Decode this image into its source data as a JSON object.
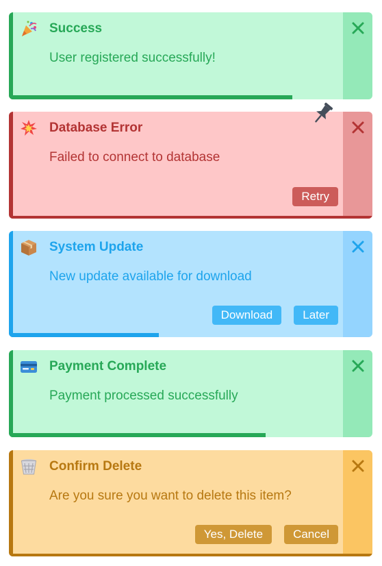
{
  "toasts": [
    {
      "type": "success",
      "icon": "party-popper-icon",
      "title": "Success",
      "message": "User registered successfully!",
      "close_label": "✕",
      "progress": 0.79,
      "actions": []
    },
    {
      "type": "error",
      "icon": "collision-icon",
      "title": "Database Error",
      "message": "Failed to connect to database",
      "close_label": "✕",
      "pinned": true,
      "actions": [
        "Retry"
      ]
    },
    {
      "type": "info",
      "icon": "package-icon",
      "title": "System Update",
      "message": "New update available for download",
      "close_label": "✕",
      "progress": 0.41,
      "actions": [
        "Download",
        "Later"
      ]
    },
    {
      "type": "success",
      "icon": "credit-card-icon",
      "title": "Payment Complete",
      "message": "Payment processed successfully",
      "close_label": "✕",
      "progress": 0.7,
      "actions": []
    },
    {
      "type": "warning",
      "icon": "wastebasket-icon",
      "title": "Confirm Delete",
      "message": "Are you sure you want to delete this item?",
      "close_label": "✕",
      "actions": [
        "Yes, Delete",
        "Cancel"
      ]
    }
  ],
  "colors": {
    "success": "#27a857",
    "error": "#b33434",
    "info": "#1ea4ec",
    "warning": "#b77811"
  }
}
